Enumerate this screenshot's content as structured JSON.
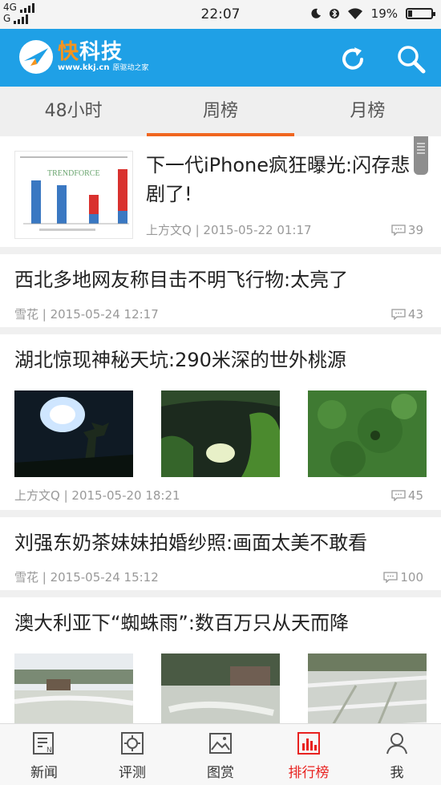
{
  "status": {
    "net1": "4G",
    "net2": "G",
    "time": "22:07",
    "battery": "19%",
    "battery_level": 0.19
  },
  "header": {
    "brand": "快科技",
    "url": "www.kkj.cn",
    "tagline": "原驱动之家",
    "refresh_icon": "refresh-icon",
    "search_icon": "search-icon",
    "color": "#1fa0e6"
  },
  "tabs": [
    {
      "label": "48小时"
    },
    {
      "label": "周榜",
      "active": true
    },
    {
      "label": "月榜"
    }
  ],
  "articles": [
    {
      "title": "下一代iPhone疯狂曝光:闪存悲剧了!",
      "author_time": "上方文Q | 2015-05-22 01:17",
      "comments": "39",
      "thumb_brand": "TRENDFORCE"
    },
    {
      "title": "西北多地网友称目击不明飞行物:太亮了",
      "author_time": "雪花 | 2015-05-24 12:17",
      "comments": "43"
    },
    {
      "title": "湖北惊现神秘天坑:290米深的世外桃源",
      "author_time": "上方文Q | 2015-05-20 18:21",
      "comments": "45"
    },
    {
      "title": "刘强东奶茶妹妹拍婚纱照:画面太美不敢看",
      "author_time": "雪花 | 2015-05-24 15:12",
      "comments": "100"
    },
    {
      "title": "澳大利亚下“蜘蛛雨”:数百万只从天而降"
    }
  ],
  "bottom_nav": [
    {
      "label": "新闻",
      "icon": "news-icon"
    },
    {
      "label": "评测",
      "icon": "review-icon"
    },
    {
      "label": "图赏",
      "icon": "gallery-icon"
    },
    {
      "label": "排行榜",
      "icon": "ranking-icon",
      "active": true
    },
    {
      "label": "我",
      "icon": "profile-icon"
    }
  ],
  "colors": {
    "accent_tab": "#f0661f",
    "active_nav": "#e8211f"
  }
}
